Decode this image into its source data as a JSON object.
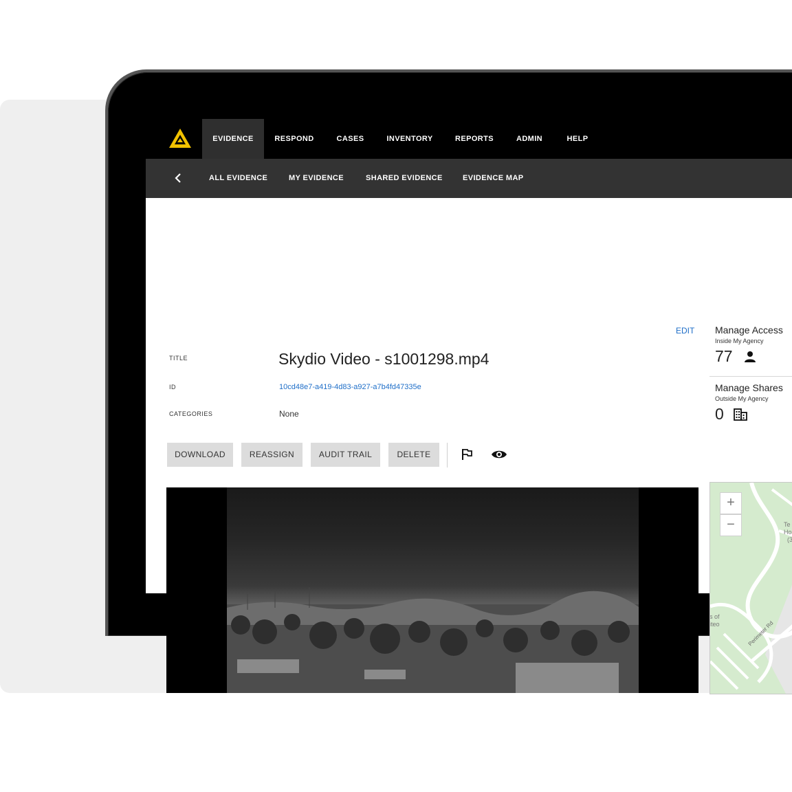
{
  "nav": {
    "tabs": [
      {
        "label": "EVIDENCE",
        "active": true
      },
      {
        "label": "RESPOND"
      },
      {
        "label": "CASES"
      },
      {
        "label": "INVENTORY"
      },
      {
        "label": "REPORTS"
      },
      {
        "label": "ADMIN"
      },
      {
        "label": "HELP"
      }
    ]
  },
  "subnav": {
    "links": [
      "ALL EVIDENCE",
      "MY EVIDENCE",
      "SHARED EVIDENCE",
      "EVIDENCE MAP"
    ]
  },
  "details": {
    "edit": "EDIT",
    "title_label": "TITLE",
    "title": "Skydio Video - s1001298.mp4",
    "id_label": "ID",
    "id": "10cd48e7-a419-4d83-a927-a7b4fd47335e",
    "categories_label": "CATEGORIES",
    "categories": "None"
  },
  "actions": {
    "download": "DOWNLOAD",
    "reassign": "REASSIGN",
    "audit_trail": "AUDIT TRAIL",
    "delete": "DELETE",
    "icons": [
      "flag-icon",
      "eye-icon"
    ]
  },
  "access": {
    "title": "Manage Access",
    "subtitle": "Inside My Agency",
    "count": "77",
    "icon": "person-icon"
  },
  "shares": {
    "title": "Manage Shares",
    "subtitle": "Outside My Agency",
    "count": "0",
    "icon": "building-icon"
  },
  "map": {
    "zoom_in": "+",
    "zoom_out": "−",
    "labels": [
      "Te",
      "Ho",
      "(3",
      "s of",
      "iteo",
      "Perimeter Rd"
    ]
  },
  "colors": {
    "accent": "#1e6ec8",
    "logo": "#f2c200",
    "nav_bg": "#000000",
    "subnav_bg": "#333333"
  }
}
